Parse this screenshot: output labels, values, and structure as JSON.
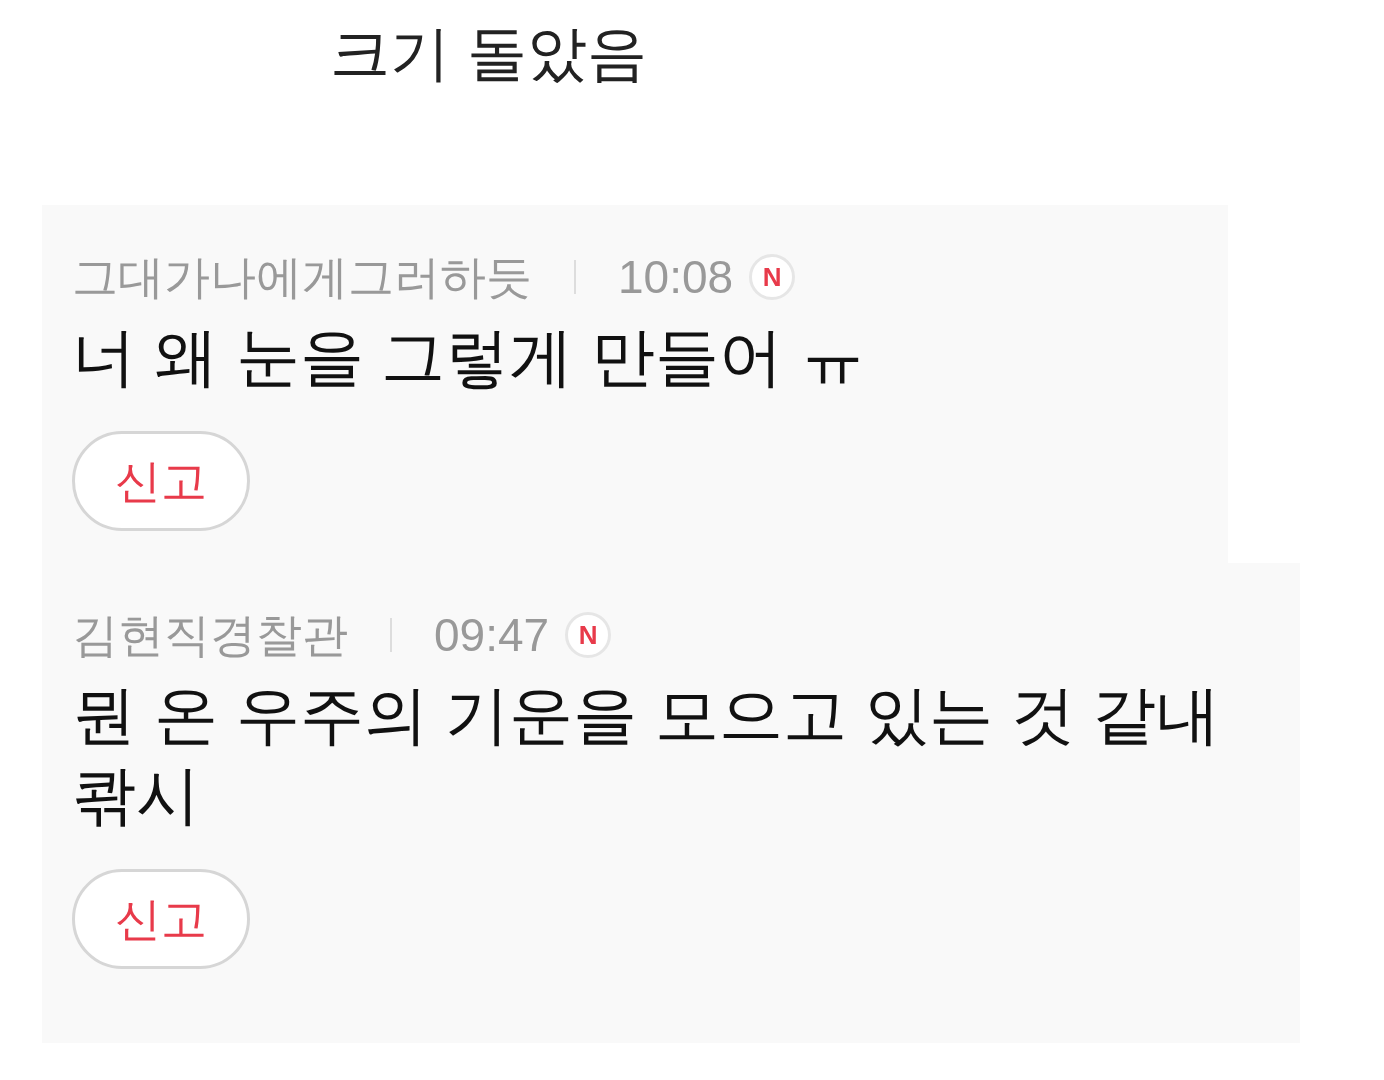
{
  "title": "크기 돌았음",
  "comments": [
    {
      "author": "그대가나에게그러하듯",
      "time": "10:08",
      "new": true,
      "new_badge": "N",
      "body": "너 왜 눈을 그렇게 만들어 ㅠ",
      "report": "신고"
    },
    {
      "author": "김현직경찰관",
      "time": "09:47",
      "new": true,
      "new_badge": "N",
      "body": "뭔 온 우주의 기운을 모으고 있는 것 같내 콲시",
      "report": "신고"
    }
  ]
}
